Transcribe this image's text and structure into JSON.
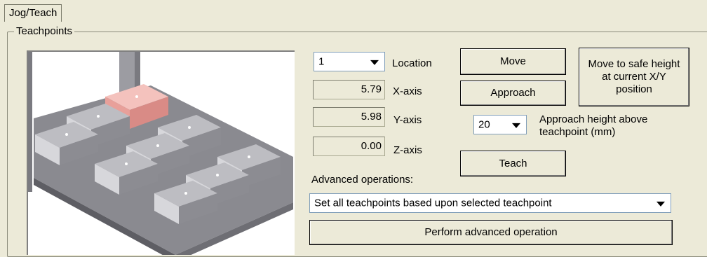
{
  "tab": {
    "label": "Jog/Teach"
  },
  "group": {
    "title": "Teachpoints"
  },
  "location": {
    "value": "1",
    "label": "Location"
  },
  "axes": [
    {
      "value": "5.79",
      "label": "X-axis"
    },
    {
      "value": "5.98",
      "label": "Y-axis"
    },
    {
      "value": "0.00",
      "label": "Z-axis"
    }
  ],
  "buttons": {
    "move": "Move",
    "approach": "Approach",
    "teach": "Teach",
    "safe_height": "Move to safe height\nat current X/Y\nposition",
    "perform": "Perform advanced operation"
  },
  "approach_height": {
    "value": "20",
    "label": "Approach height above\nteachpoint (mm)"
  },
  "advanced": {
    "label": "Advanced operations:",
    "selected": "Set all teachpoints based upon selected teachpoint"
  },
  "colors": {
    "highlight_plate": "#f2b4b0",
    "deck": "#8e8e94",
    "plate": "#a9a9ad"
  },
  "viewport": {
    "icon": "robot-deck-3d-view"
  }
}
